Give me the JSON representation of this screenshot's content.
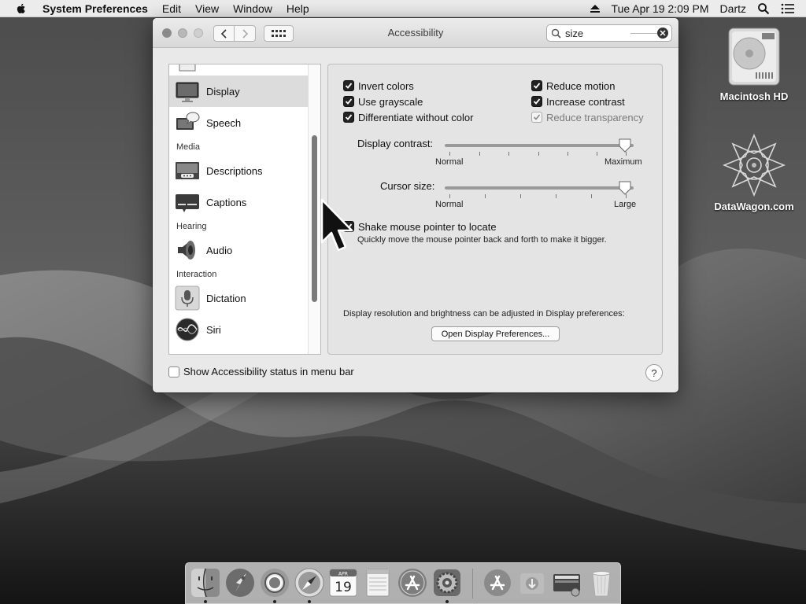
{
  "menubar": {
    "app_name": "System Preferences",
    "items": [
      "Edit",
      "View",
      "Window",
      "Help"
    ],
    "datetime": "Tue Apr 19  2:09 PM",
    "user": "Dartz"
  },
  "window": {
    "title": "Accessibility",
    "search": {
      "value": "size"
    }
  },
  "sidebar": {
    "items": [
      {
        "label": "Display",
        "icon": "display-icon",
        "selected": true
      },
      {
        "label": "Speech",
        "icon": "speech-icon"
      },
      {
        "section": "Media"
      },
      {
        "label": "Descriptions",
        "icon": "descriptions-icon"
      },
      {
        "label": "Captions",
        "icon": "captions-icon"
      },
      {
        "section": "Hearing"
      },
      {
        "label": "Audio",
        "icon": "audio-icon"
      },
      {
        "section": "Interaction"
      },
      {
        "label": "Dictation",
        "icon": "microphone-icon"
      },
      {
        "label": "Siri",
        "icon": "siri-icon"
      }
    ]
  },
  "display": {
    "options": {
      "invert_colors": {
        "label": "Invert colors",
        "checked": true
      },
      "use_grayscale": {
        "label": "Use grayscale",
        "checked": true
      },
      "differentiate": {
        "label": "Differentiate without color",
        "checked": true
      },
      "reduce_motion": {
        "label": "Reduce motion",
        "checked": true
      },
      "increase_contrast": {
        "label": "Increase contrast",
        "checked": true
      },
      "reduce_transparency": {
        "label": "Reduce transparency",
        "checked": true,
        "disabled": true
      }
    },
    "contrast": {
      "label": "Display contrast:",
      "min_label": "Normal",
      "max_label": "Maximum",
      "value": 1.0
    },
    "cursor_size": {
      "label": "Cursor size:",
      "min_label": "Normal",
      "max_label": "Large",
      "value": 1.0
    },
    "shake": {
      "label": "Shake mouse pointer to locate",
      "description": "Quickly move the mouse pointer back and forth to make it bigger.",
      "checked": true
    },
    "resolution_hint": "Display resolution and brightness can be adjusted in Display preferences:",
    "open_button": "Open Display Preferences..."
  },
  "footer": {
    "status_label": "Show Accessibility status in menu bar",
    "status_checked": false,
    "help": "?"
  },
  "desktop": {
    "icons": [
      {
        "label": "Macintosh HD",
        "icon": "hard-drive-icon"
      },
      {
        "label": "DataWagon.com",
        "icon": "datawagon-icon"
      }
    ]
  },
  "dock": {
    "calendar_month": "APR",
    "calendar_day": "19",
    "items": [
      "finder-icon",
      "launchpad-icon",
      "chrome-icon",
      "safari-icon",
      "calendar-icon",
      "notes-icon",
      "app-store-icon",
      "system-preferences-icon",
      "app-store-downloads-icon",
      "downloads-icon",
      "drive-icon",
      "trash-icon"
    ]
  },
  "colors": {
    "window_bg": "#e9e9e9",
    "selection": "#dcdcdc",
    "checkbox": "#222222"
  }
}
